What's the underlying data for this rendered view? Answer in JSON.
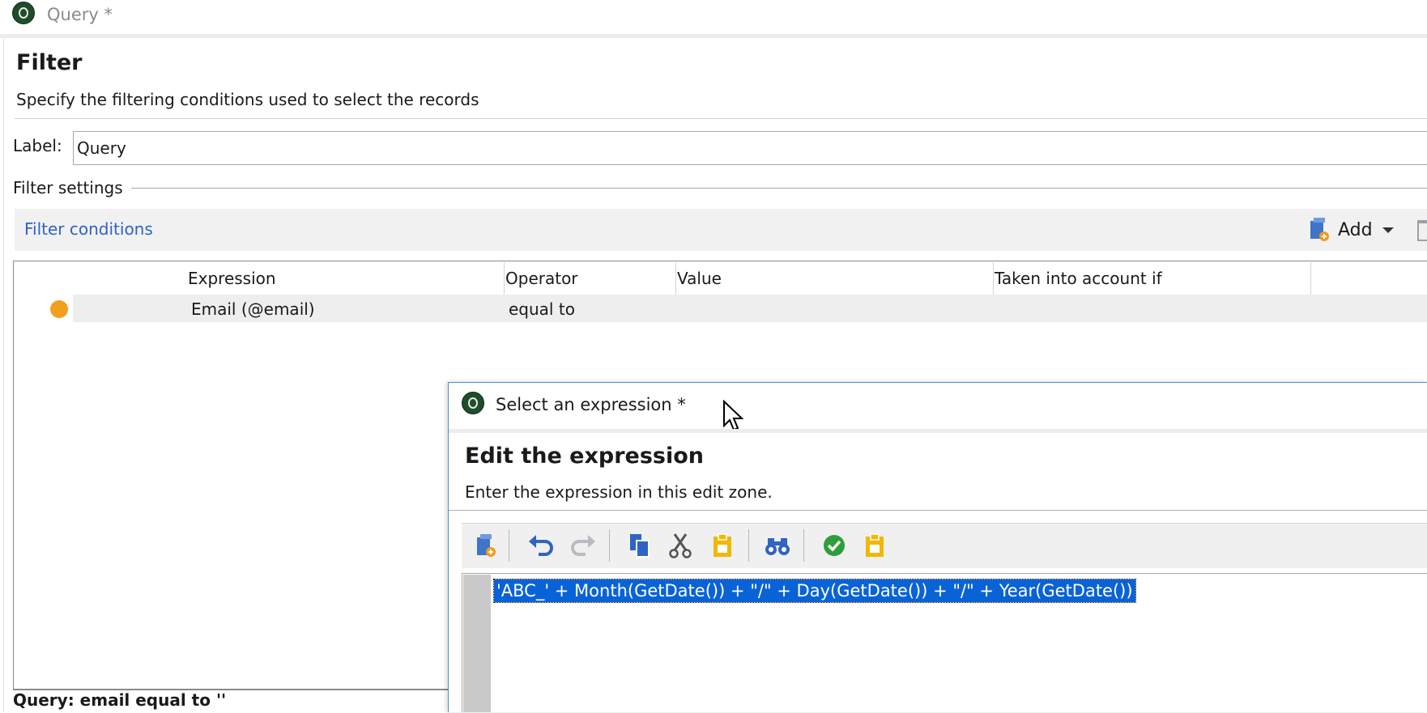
{
  "window": {
    "title": "Query *"
  },
  "filter": {
    "title": "Filter",
    "subtitle": "Specify the filtering conditions used to select the records",
    "label_caption": "Label:",
    "label_value": "Query",
    "settings_legend": "Filter settings",
    "conditions_title": "Filter conditions",
    "add_label": "Add"
  },
  "grid": {
    "columns": [
      "Expression",
      "Operator",
      "Value",
      "Taken into account if"
    ],
    "rows": [
      {
        "expression": "Email (@email)",
        "operator": "equal to",
        "value": "",
        "condition": ""
      }
    ]
  },
  "status": {
    "text": "Query: email equal to ''"
  },
  "dialog": {
    "title": "Select an expression *",
    "heading": "Edit the expression",
    "subtitle": "Enter the expression in this edit zone.",
    "expression": "'ABC_' + Month(GetDate()) + \"/\" + Day(GetDate()) + \"/\" + Year(GetDate())",
    "toolbar_icons": [
      "insert-function-icon",
      "undo-icon",
      "redo-icon",
      "copy-icon",
      "cut-icon",
      "paste-icon",
      "find-icon",
      "validate-icon",
      "clipboard-icon"
    ]
  },
  "colors": {
    "link_blue": "#2e62c8",
    "selection_blue": "#0a63d6",
    "status_dot": "#f0a01c",
    "validate_green": "#2e9e3a",
    "paste_yellow": "#f2b705"
  }
}
